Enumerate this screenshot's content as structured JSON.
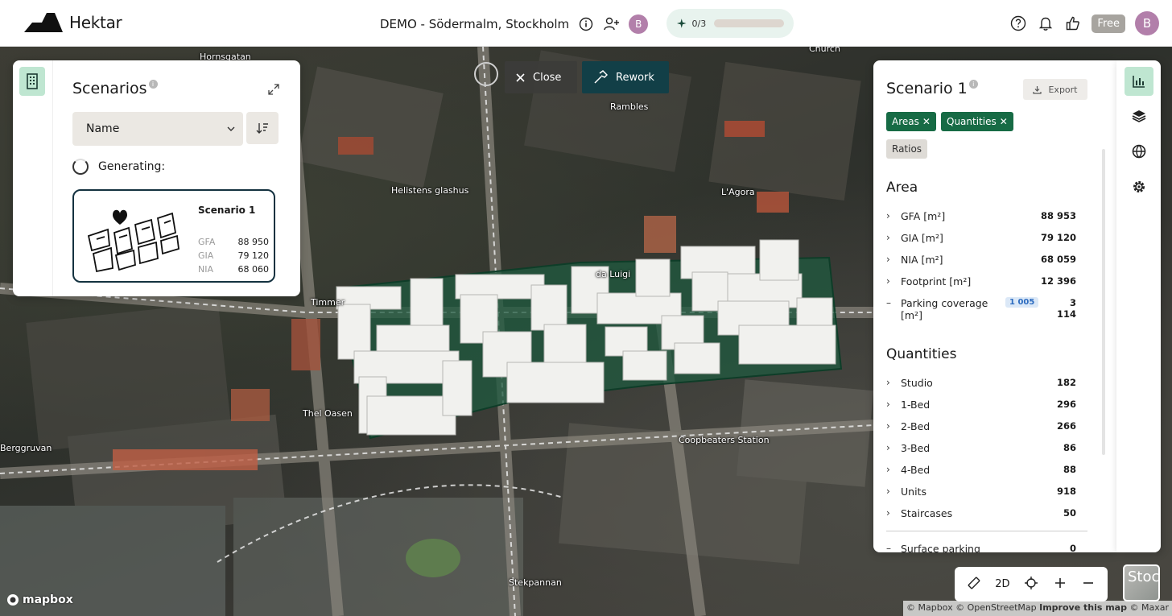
{
  "app": {
    "name": "Hektar"
  },
  "header": {
    "project_title": "DEMO - Södermalm, Stockholm",
    "collaborator_initial": "B",
    "credits_text": "0/3",
    "credits_progress": 0,
    "plan_badge": "Free",
    "user_initial": "B"
  },
  "map_actions": {
    "close_label": "Close",
    "rework_label": "Rework"
  },
  "map_labels": [
    "Hornsgatan",
    "Church",
    "Rambles",
    "Helistens glashus",
    "L'Agora",
    "da Luigi",
    "Timmer",
    "Thel Oasen",
    "Berggruvan",
    "Coopbeaters Station",
    "Stekpannan"
  ],
  "scenarios_panel": {
    "title": "Scenarios",
    "sort_by": "Name",
    "generating_label": "Generating:",
    "cards": [
      {
        "name": "Scenario 1",
        "stats": [
          {
            "label": "GFA",
            "value": "88 950"
          },
          {
            "label": "GIA",
            "value": "79 120"
          },
          {
            "label": "NIA",
            "value": "68 060"
          }
        ]
      }
    ]
  },
  "info_panel": {
    "title": "Scenario 1",
    "export_label": "Export",
    "active_tags": [
      "Areas",
      "Quantities"
    ],
    "inactive_tags": [
      "Ratios"
    ],
    "area": {
      "title": "Area",
      "rows": [
        {
          "label": "GFA [m²]",
          "value": "88 953"
        },
        {
          "label": "GIA [m²]",
          "value": "79 120"
        },
        {
          "label": "NIA [m²]",
          "value": "68 059"
        },
        {
          "label": "Footprint [m²]",
          "value": "12 396"
        },
        {
          "label": "Parking coverage [m²]",
          "badge": "1 005",
          "value": "3 114"
        }
      ]
    },
    "quantities": {
      "title": "Quantities",
      "rows": [
        {
          "label": "Studio",
          "value": "182"
        },
        {
          "label": "1-Bed",
          "value": "296"
        },
        {
          "label": "2-Bed",
          "value": "266"
        },
        {
          "label": "3-Bed",
          "value": "86"
        },
        {
          "label": "4-Bed",
          "value": "88"
        },
        {
          "label": "Units",
          "value": "918"
        },
        {
          "label": "Staircases",
          "value": "50"
        },
        {
          "label": "Surface parking",
          "value": "0"
        }
      ]
    }
  },
  "map_controls": {
    "view_mode": "2D"
  },
  "minimap": {
    "label": "Stoc"
  },
  "attribution": {
    "brand": "mapbox",
    "mapbox": "© Mapbox",
    "osm": "© OpenStreetMap",
    "improve": "Improve this map",
    "maxar": "© Maxar"
  },
  "colors": {
    "accent_green": "#176b45",
    "rail_active": "#bfe6d1",
    "rework_button": "#123f47",
    "avatar": "#b27faa"
  }
}
